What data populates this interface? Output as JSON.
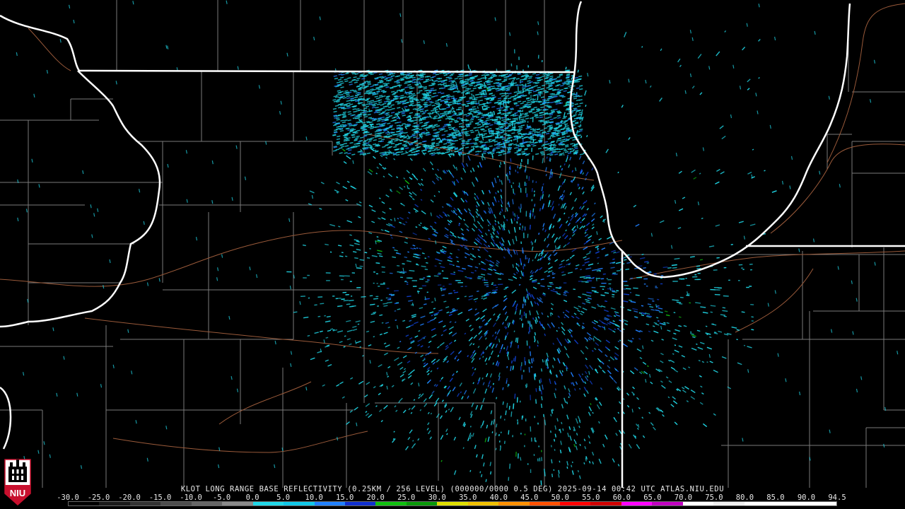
{
  "product": {
    "caption": "KLOT LONG RANGE BASE REFLECTIVITY (0.25KM / 256 LEVEL) (000000/0000 0.5 DEG) 2025-09-14 00:42 UTC  ATLAS.NIU.EDU"
  },
  "scale": {
    "labels": [
      "-30.0",
      "-25.0",
      "-20.0",
      "-15.0",
      "-10.0",
      "-5.0",
      "0.0",
      "5.0",
      "10.0",
      "15.0",
      "20.0",
      "25.0",
      "30.0",
      "35.0",
      "40.0",
      "45.0",
      "50.0",
      "55.0",
      "60.0",
      "65.0",
      "70.0",
      "75.0",
      "80.0",
      "85.0",
      "90.0",
      "94.5"
    ],
    "colors": [
      "#000000",
      "#1a1a1a",
      "#333333",
      "#4d4d4d",
      "#666666",
      "#8a8a8a",
      "#20d8e8",
      "#10c8e8",
      "#2080ff",
      "#1030d0",
      "#10c010",
      "#0a9a0a",
      "#e0e000",
      "#f0c000",
      "#ff9000",
      "#ff5000",
      "#ff0000",
      "#d00000",
      "#ff00ff",
      "#c000c0",
      "#ffffff",
      "#f0f0f0",
      "#ffffff",
      "#ffffff",
      "#ffffff"
    ]
  },
  "logo": {
    "text": "NIU"
  },
  "colors": {
    "state_border": "#ffffff",
    "county_line": "#7a7a7a",
    "highway": "#9a5a3a",
    "echo_light": "#20d8e8",
    "echo_mid": "#2080ff",
    "echo_deep": "#1040d0",
    "echo_green": "#10c010"
  }
}
